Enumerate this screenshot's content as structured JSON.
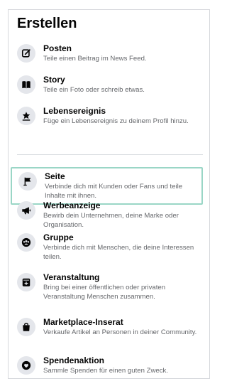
{
  "create_menu": {
    "title": "Erstellen",
    "items": [
      {
        "icon": "compose-icon",
        "label": "Posten",
        "desc": "Teile einen Beitrag im News Feed."
      },
      {
        "icon": "book-icon",
        "label": "Story",
        "desc": "Teile ein Foto oder schreib etwas."
      },
      {
        "icon": "star-award-icon",
        "label": "Lebensereignis",
        "desc": "Füge ein Lebensereignis zu deinem Profil hinzu."
      },
      {
        "icon": "flag-icon",
        "label": "Seite",
        "desc": "Verbinde dich mit Kunden oder Fans und teile Inhalte mit ihnen."
      },
      {
        "icon": "megaphone-icon",
        "label": "Werbeanzeige",
        "desc": "Bewirb dein Unternehmen, deine Marke oder Organisation."
      },
      {
        "icon": "group-icon",
        "label": "Gruppe",
        "desc": "Verbinde dich mit Menschen, die deine Interessen teilen."
      },
      {
        "icon": "calendar-plus-icon",
        "label": "Veranstaltung",
        "desc": "Bring bei einer öffentlichen oder privaten Veranstaltung Menschen zusammen."
      },
      {
        "icon": "shopping-bag-icon",
        "label": "Marketplace-Inserat",
        "desc": "Verkaufe Artikel an Personen in deiner Community."
      },
      {
        "icon": "heart-hand-icon",
        "label": "Spendenaktion",
        "desc": "Sammle Spenden für einen guten Zweck."
      }
    ]
  },
  "colors": {
    "highlight_border": "#9ad6c6",
    "icon_bg": "#e4e6eb",
    "primary_text": "#050505",
    "secondary_text": "#65676b"
  }
}
